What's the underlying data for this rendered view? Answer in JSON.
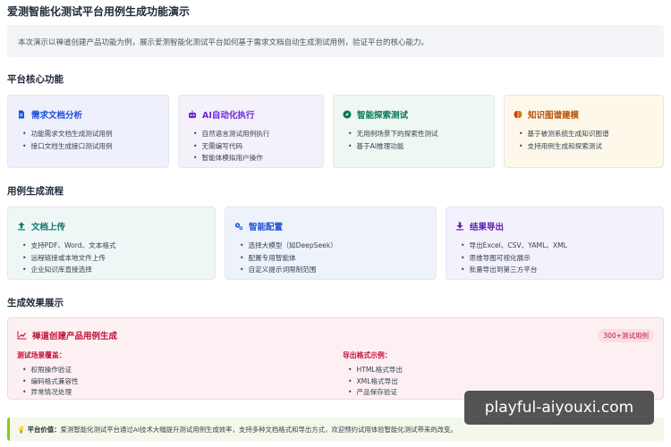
{
  "title": "爱测智能化测试平台用例生成功能演示",
  "intro": "本次演示以禅道创建产品功能为例，展示爱测智能化测试平台如何基于需求文档自动生成测试用例，验证平台的核心能力。",
  "core": {
    "heading": "平台核心功能",
    "cards": [
      {
        "icon": "document-icon",
        "title": "需求文档分析",
        "color": "#1d4ed8",
        "items": [
          "功能需求文档生成测试用例",
          "接口文档生成接口测试用例"
        ]
      },
      {
        "icon": "robot-icon",
        "title": "AI自动化执行",
        "color": "#6d28d9",
        "items": [
          "自然语言测试用例执行",
          "无需编写代码",
          "智能体模拟用户操作"
        ]
      },
      {
        "icon": "compass-icon",
        "title": "智能探索测试",
        "color": "#047857",
        "items": [
          "无用例场景下的探索性测试",
          "基于AI推理功能"
        ]
      },
      {
        "icon": "brain-icon",
        "title": "知识图谱建模",
        "color": "#b45309",
        "items": [
          "基于被测系统生成知识图谱",
          "支持用例生成和探索测试"
        ]
      }
    ]
  },
  "flow": {
    "heading": "用例生成流程",
    "cards": [
      {
        "icon": "upload-icon",
        "title": "文档上传",
        "color": "#0f766e",
        "items": [
          "支持PDF、Word、文本格式",
          "远程链接或本地文件上传",
          "企业知识库直接选择"
        ]
      },
      {
        "icon": "gears-icon",
        "title": "智能配置",
        "color": "#1d4ed8",
        "items": [
          "选择大模型（如DeepSeek）",
          "配置专用智能体",
          "自定义提示词限制范围"
        ]
      },
      {
        "icon": "download-icon",
        "title": "结果导出",
        "color": "#5b21b6",
        "items": [
          "导出Excel、CSV、YAML、XML",
          "思维导图可视化展示",
          "批量导出到第三方平台"
        ]
      }
    ]
  },
  "result": {
    "heading": "生成效果展示",
    "card_title": "禅道创建产品用例生成",
    "badge": "300+测试用例",
    "left_sub": "测试场景覆盖：",
    "left_items": [
      "权限操作验证",
      "编码格式兼容性",
      "异常情况处理"
    ],
    "right_sub": "导出格式示例：",
    "right_items": [
      "HTML格式导出",
      "XML格式导出",
      "产品保存验证"
    ]
  },
  "value": {
    "label": "平台价值：",
    "text": "爱测智能化测试平台通过AI技术大幅提升测试用例生成效率，支持多种文档格式和导出方式，欢迎预约试用体验智能化测试带来的改变。"
  },
  "watermark": "playful-aiyouxi.com"
}
